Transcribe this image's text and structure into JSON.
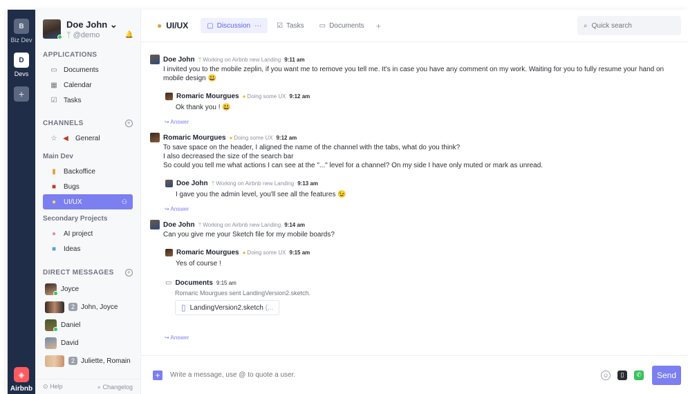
{
  "rail": {
    "workspaces": [
      {
        "initial": "B",
        "label": "Biz Dev",
        "active": false
      },
      {
        "initial": "D",
        "label": "Devs",
        "active": true
      }
    ],
    "add_label": "+",
    "bottom_label": "Airbnb"
  },
  "profile": {
    "name": "Doe John",
    "chevron": "⌄",
    "handle": "@demo"
  },
  "sidebar": {
    "applications_title": "APPLICATIONS",
    "applications": [
      {
        "label": "Documents",
        "icon": "folder-icon"
      },
      {
        "label": "Calendar",
        "icon": "calendar-icon"
      },
      {
        "label": "Tasks",
        "icon": "checkbox-icon"
      }
    ],
    "channels_title": "CHANNELS",
    "channels": [
      {
        "label": "General"
      }
    ],
    "main_dev_title": "Main Dev",
    "main_dev": [
      {
        "label": "Backoffice"
      },
      {
        "label": "Bugs"
      },
      {
        "label": "UI/UX",
        "active": true
      }
    ],
    "secondary_title": "Secondary Projects",
    "secondary": [
      {
        "label": "AI project"
      },
      {
        "label": "Ideas"
      }
    ],
    "dm_title": "DIRECT MESSAGES",
    "dms": [
      {
        "label": "Joyce",
        "count": ""
      },
      {
        "label": "John, Joyce",
        "count": "2"
      },
      {
        "label": "Daniel",
        "count": ""
      },
      {
        "label": "David",
        "count": ""
      },
      {
        "label": "Juliette, Romain",
        "count": "2"
      }
    ],
    "footer_help": "Help",
    "footer_changelog": "Changelog"
  },
  "topbar": {
    "channel": "UI/UX",
    "tabs": [
      {
        "label": "Discussion",
        "active": true
      },
      {
        "label": "Tasks",
        "active": false
      },
      {
        "label": "Documents",
        "active": false
      }
    ],
    "more": "···",
    "add": "+",
    "search_placeholder": "Quick search"
  },
  "messages": {
    "m1": {
      "name": "Doe John",
      "status": "Working on Airbnb new Landing",
      "time": "9:11 am",
      "text": "I invited you to the mobile zeplin, if you want me to remove you tell me. It's in case you have any comment on my work. Waiting for you to fully resume your hand on mobile design 😃"
    },
    "m1r": {
      "name": "Romaric Mourgues",
      "status": "Doing some UX",
      "time": "9:12 am",
      "text": "Ok thank you ! 😃"
    },
    "m2": {
      "name": "Romaric Mourgues",
      "status": "Doing some UX",
      "time": "9:12 am",
      "line1": "To save space on the header, I aligned the name of the channel with the tabs, what do you think?",
      "line2": "I also decreased the size of the search bar",
      "line3": "So could you tell me what actions I can see at the \"...\" level for a channel? On my side I have only muted or mark as unread."
    },
    "m2r": {
      "name": "Doe John",
      "status": "Working on Airbnb new Landing",
      "time": "9:13 am",
      "text": "I gave you the admin level, you'll see all the features 😉"
    },
    "m3": {
      "name": "Doe John",
      "status": "Working on Airbnb new Landing",
      "time": "9:14 am",
      "text": "Can you give me your Sketch file for my mobile boards?"
    },
    "m3r": {
      "name": "Romaric Mourgues",
      "status": "Doing some UX",
      "time": "9:15 am",
      "text": "Yes of course !"
    },
    "doc": {
      "title": "Documents",
      "time": "9:15 am",
      "sub": "Romaric Mourgues sent LandingVersion2.sketch.",
      "file": "LandingVersion2.sketch",
      "ext": "(..."
    },
    "answer": "↪ Answer"
  },
  "composer": {
    "placeholder": "Write a message, use @ to quote a user.",
    "send": "Send"
  },
  "colors": {
    "accent": "#7b7ff0",
    "rail": "#1f2d49",
    "online": "#35c45a"
  }
}
